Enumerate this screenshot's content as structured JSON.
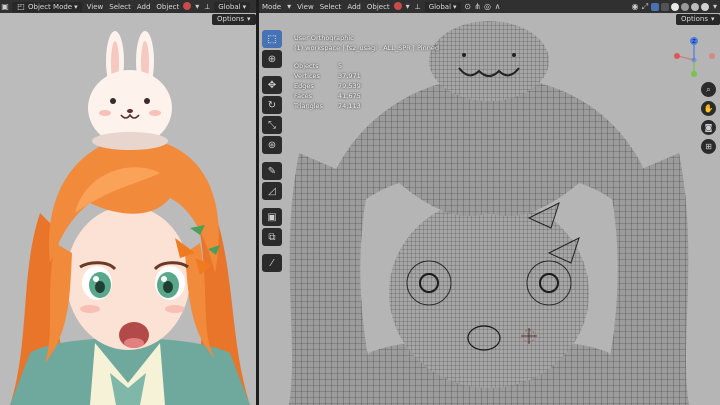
{
  "left_header": {
    "mode": "Object Mode",
    "menus": [
      "View",
      "Select",
      "Add",
      "Object"
    ],
    "transform": "Global",
    "options": "Options"
  },
  "right_header": {
    "mode_suffix": "Mode",
    "menus": [
      "View",
      "Select",
      "Add",
      "Object"
    ],
    "transform": "Global",
    "options": "Options"
  },
  "overlay": {
    "view_name": "User Orthographic",
    "collection": "(1) workspace | fs2_usagi : ALL_SPR | Pinned",
    "stats": [
      {
        "label": "Objects",
        "value": "5"
      },
      {
        "label": "Vertices",
        "value": "37,971"
      },
      {
        "label": "Edges",
        "value": "79,539"
      },
      {
        "label": "Faces",
        "value": "41,675"
      },
      {
        "label": "Triangles",
        "value": "74,113"
      }
    ]
  },
  "gizmo": {
    "z_label": "Z",
    "x_label": "X",
    "y_label": "Y"
  },
  "colors": {
    "header": "#303030",
    "accent": "#4772b3",
    "viewport": "#3f3f3f",
    "hair": "#f28a3b",
    "bunny": "#fdf2ec"
  },
  "icons": {
    "toolbar": [
      "select-box-icon",
      "cursor-icon",
      "move-icon",
      "rotate-icon",
      "scale-icon",
      "transform-icon",
      "annotate-icon",
      "measure-icon",
      "add-cube-icon",
      "extrude-icon",
      "brush-icon"
    ],
    "nav": [
      "zoom-icon",
      "hand-icon",
      "camera-icon",
      "grid-icon"
    ]
  }
}
